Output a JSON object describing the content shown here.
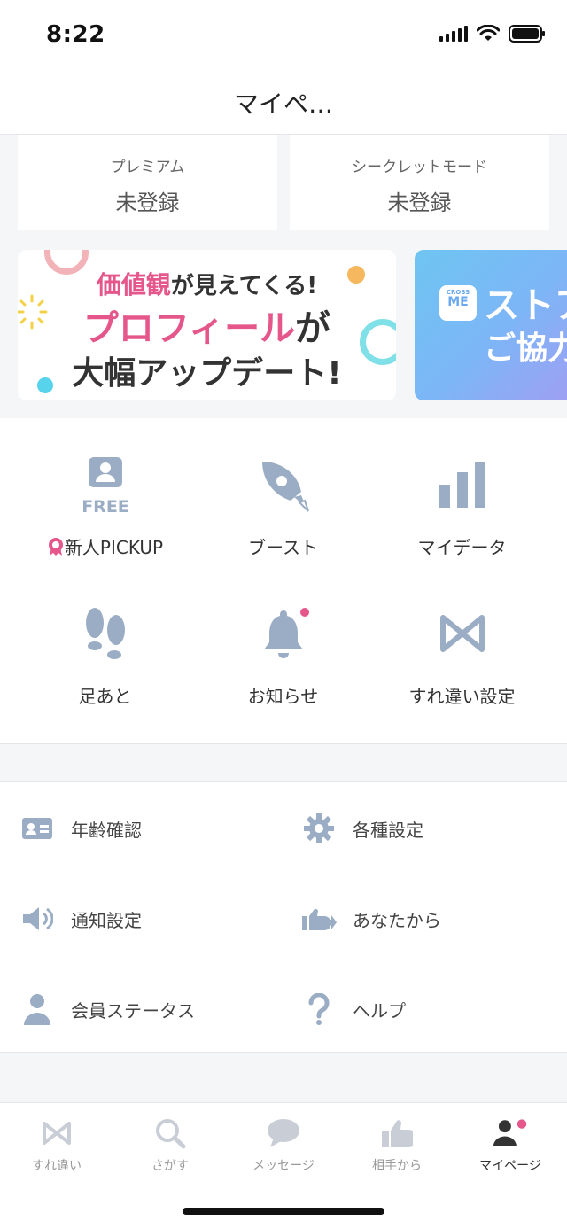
{
  "status_bar": {
    "time": "8:22"
  },
  "header": {
    "title": "マイペ…"
  },
  "cards": [
    {
      "label": "プレミアム",
      "value": "未登録"
    },
    {
      "label": "シークレットモード",
      "value": "未登録"
    }
  ],
  "banner1": {
    "line1_highlight": "価値観",
    "line1_rest": "が見えてくる!",
    "line2_highlight": "プロフィール",
    "line2_rest": "が",
    "line3": "大幅アップデート!"
  },
  "banner2": {
    "logo_small": "CROSS",
    "logo_big": "ME",
    "text1": "ストア",
    "text2": "ご協力"
  },
  "features": [
    {
      "label": "新人PICKUP",
      "icon": "free-pickup-icon",
      "badge_text": "FREE"
    },
    {
      "label": "ブースト",
      "icon": "rocket-icon"
    },
    {
      "label": "マイデータ",
      "icon": "bar-chart-icon"
    },
    {
      "label": "足あと",
      "icon": "footprints-icon"
    },
    {
      "label": "お知らせ",
      "icon": "bell-icon"
    },
    {
      "label": "すれ違い設定",
      "icon": "crossme-logo-icon"
    }
  ],
  "settings": [
    {
      "label": "年齢確認",
      "icon": "id-card-icon"
    },
    {
      "label": "各種設定",
      "icon": "gear-icon"
    },
    {
      "label": "通知設定",
      "icon": "speaker-icon"
    },
    {
      "label": "あなたから",
      "icon": "thumbs-up-arrow-icon"
    },
    {
      "label": "会員ステータス",
      "icon": "person-icon"
    },
    {
      "label": "ヘルプ",
      "icon": "question-icon"
    }
  ],
  "tabs": [
    {
      "label": "すれ違い",
      "icon": "crossme-logo-icon",
      "active": false
    },
    {
      "label": "さがす",
      "icon": "search-icon",
      "active": false
    },
    {
      "label": "メッセージ",
      "icon": "chat-bubble-icon",
      "active": false
    },
    {
      "label": "相手から",
      "icon": "thumbs-up-icon",
      "active": false
    },
    {
      "label": "マイページ",
      "icon": "user-icon",
      "active": true
    }
  ],
  "colors": {
    "icon_gray": "#9badc4",
    "accent_pink": "#e5578b",
    "tab_inactive": "#c8cdd6"
  }
}
